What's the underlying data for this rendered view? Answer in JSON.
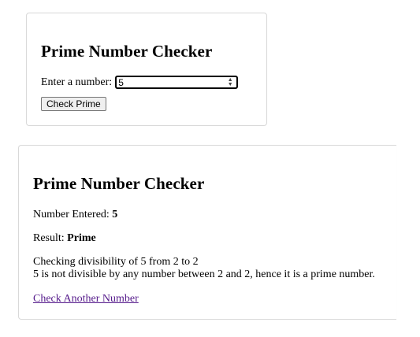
{
  "checker_form": {
    "title": "Prime Number Checker",
    "input_label": "Enter a number:",
    "input_value": "5",
    "submit_label": "Check Prime"
  },
  "result_panel": {
    "title": "Prime Number Checker",
    "number_label": "Number Entered:",
    "number_value": "5",
    "result_label": "Result:",
    "result_value": "Prime",
    "check_line_1": "Checking divisibility of 5 from 2 to 2",
    "check_line_2": "5 is not divisible by any number between 2 and 2, hence it is a prime number.",
    "link_label": "Check Another Number"
  },
  "colors": {
    "link": "#551a8b",
    "card_border": "#d9d9d9",
    "button_bg": "#efefef"
  },
  "icons": {
    "spinner": "up-down-spinner-icon"
  }
}
